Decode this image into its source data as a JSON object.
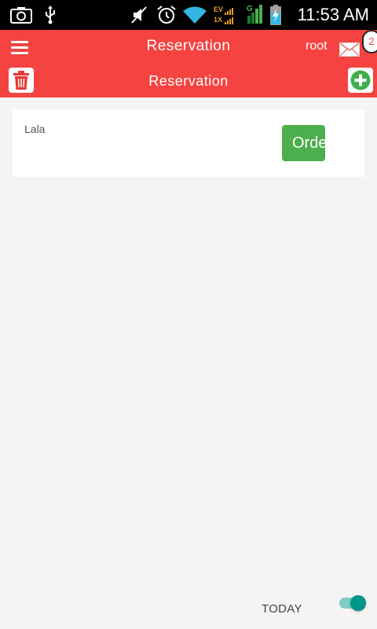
{
  "status_bar": {
    "time": "11:53 AM",
    "network_top": "EV",
    "network_bottom": "1X",
    "signal_label": "G",
    "icons": [
      "camera-icon",
      "usb-icon",
      "mute-icon",
      "alarm-icon",
      "wifi-icon",
      "signal-icon",
      "battery-icon"
    ]
  },
  "app_bar": {
    "title": "Reservation",
    "username": "root",
    "notification_count": "2",
    "subtitle": "Reservation",
    "icons": [
      "menu-icon",
      "mail-icon",
      "trash-icon",
      "add-icon"
    ]
  },
  "reservations": [
    {
      "name": "Lala",
      "action_label": "Order"
    }
  ],
  "footer": {
    "toggle_label": "TODAY",
    "toggle_on": true
  },
  "colors": {
    "primary": "#f44340",
    "order_button": "#4cae4c",
    "add_icon": "#3fae49",
    "toggle_on": "#009688"
  }
}
